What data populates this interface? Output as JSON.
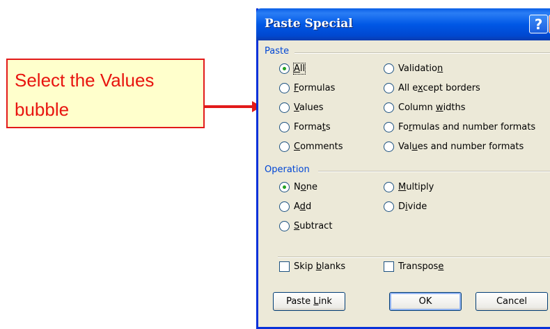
{
  "callout": {
    "text": "Select the Values bubble"
  },
  "dialog": {
    "title": "Paste Special",
    "help_glyph": "?",
    "close_glyph": "✕",
    "paste_label": "Paste",
    "paste_col1": [
      {
        "pre": "",
        "u": "A",
        "post": "ll",
        "checked": true
      },
      {
        "pre": "",
        "u": "F",
        "post": "ormulas",
        "checked": false
      },
      {
        "pre": "",
        "u": "V",
        "post": "alues",
        "checked": false
      },
      {
        "pre": "Forma",
        "u": "t",
        "post": "s",
        "checked": false
      },
      {
        "pre": "",
        "u": "C",
        "post": "omments",
        "checked": false
      }
    ],
    "paste_col2": [
      {
        "pre": "Validatio",
        "u": "n",
        "post": "",
        "checked": false
      },
      {
        "pre": "All e",
        "u": "x",
        "post": "cept borders",
        "checked": false
      },
      {
        "pre": "Column ",
        "u": "w",
        "post": "idths",
        "checked": false
      },
      {
        "pre": "Fo",
        "u": "r",
        "post": "mulas and number formats",
        "checked": false
      },
      {
        "pre": "Val",
        "u": "u",
        "post": "es and number formats",
        "checked": false
      }
    ],
    "operation_label": "Operation",
    "op_col1": [
      {
        "pre": "N",
        "u": "o",
        "post": "ne",
        "checked": true
      },
      {
        "pre": "A",
        "u": "d",
        "post": "d",
        "checked": false
      },
      {
        "pre": "",
        "u": "S",
        "post": "ubtract",
        "checked": false
      }
    ],
    "op_col2": [
      {
        "pre": "",
        "u": "M",
        "post": "ultiply",
        "checked": false
      },
      {
        "pre": "D",
        "u": "i",
        "post": "vide",
        "checked": false
      }
    ],
    "skip_blanks": {
      "pre": "Skip ",
      "u": "b",
      "post": "lanks"
    },
    "transpose": {
      "pre": "Transpos",
      "u": "e",
      "post": ""
    },
    "paste_link_button": {
      "pre": "Paste ",
      "u": "L",
      "post": "ink"
    },
    "ok_button": "OK",
    "cancel_button": "Cancel"
  }
}
